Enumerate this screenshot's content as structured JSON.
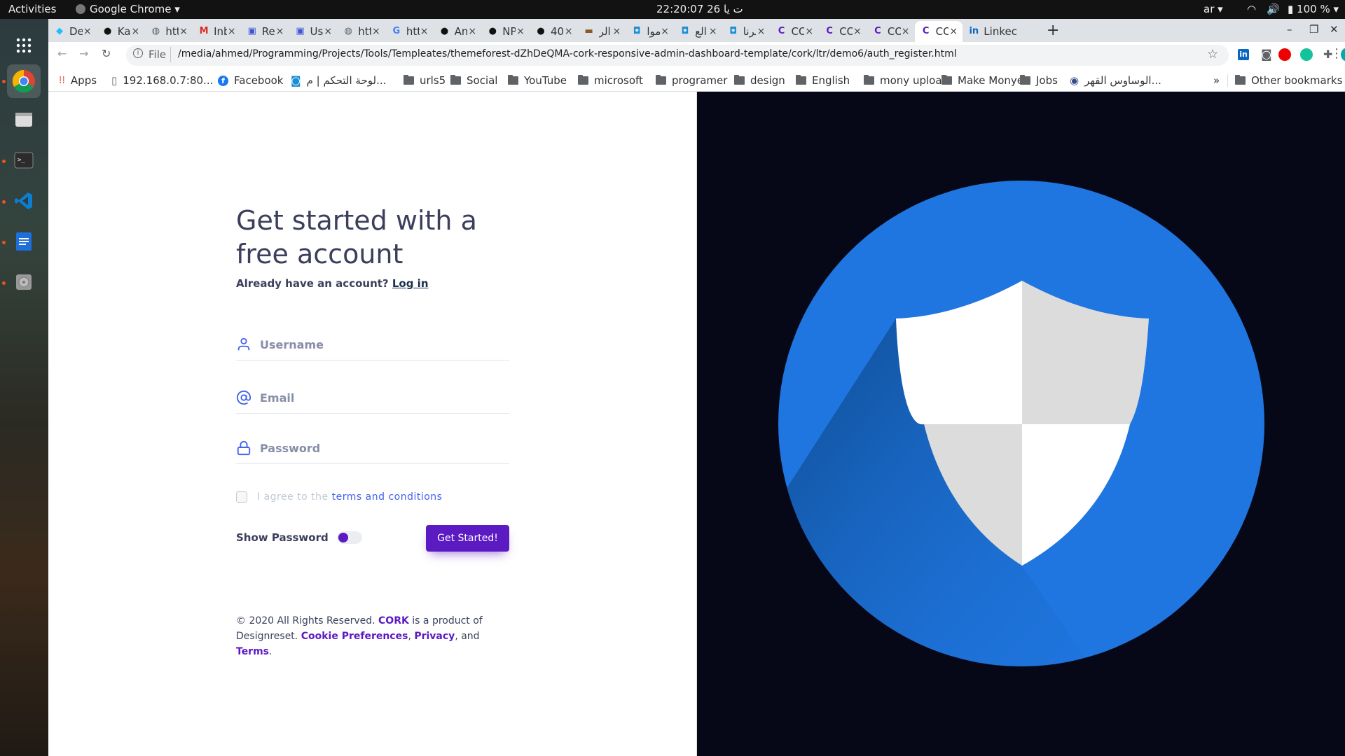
{
  "topbar": {
    "activities": "Activities",
    "app": "Google Chrome",
    "clock": "22:20:07 26 ت يا",
    "lang": "ar",
    "battery": "100 %"
  },
  "tabs": [
    {
      "label": "De",
      "icon": "kaggle-icon"
    },
    {
      "label": "Ka",
      "icon": "github-icon"
    },
    {
      "label": "htt",
      "icon": "globe-icon"
    },
    {
      "label": "Inb",
      "icon": "gmail-icon"
    },
    {
      "label": "Re",
      "icon": "doc-icon"
    },
    {
      "label": "Usi",
      "icon": "doc-icon"
    },
    {
      "label": "htt",
      "icon": "globe-icon"
    },
    {
      "label": "htt",
      "icon": "google-icon"
    },
    {
      "label": "An",
      "icon": "github-icon"
    },
    {
      "label": "NP",
      "icon": "github-icon"
    },
    {
      "label": "40",
      "icon": "github-icon"
    },
    {
      "label": "الر",
      "icon": "book-icon"
    },
    {
      "label": "موا",
      "icon": "camera-icon"
    },
    {
      "label": "الع",
      "icon": "camera-icon"
    },
    {
      "label": "برنا",
      "icon": "camera-icon"
    },
    {
      "label": "CO",
      "icon": "cork-icon"
    },
    {
      "label": "CO",
      "icon": "cork-icon"
    },
    {
      "label": "CORK",
      "icon": "cork-icon"
    },
    {
      "label": "CO",
      "icon": "cork-icon",
      "active": true
    },
    {
      "label": "Linkec",
      "icon": "linkedin-icon"
    }
  ],
  "address": {
    "scheme_label": "File",
    "url": "/media/ahmed/Programming/Projects/Tools/Templeates/themeforest-dZhDeQMA-cork-responsive-admin-dashboard-template/cork/ltr/demo6/auth_register.html"
  },
  "bookmarks": {
    "items": [
      "Apps",
      "192.168.0.7:80...",
      "Facebook",
      "لوحة التحكم | م...",
      "urls5",
      "Social",
      "YouTube",
      "microsoft",
      "programer",
      "design",
      "English",
      "mony upload",
      "Make Monye",
      "Jobs",
      "الوساوس القهر..."
    ],
    "overflow": "»",
    "other": "Other bookmarks"
  },
  "form": {
    "heading": "Get started with a free account",
    "already": "Already have an account?",
    "login": "Log in",
    "username_placeholder": "Username",
    "email_placeholder": "Email",
    "password_placeholder": "Password",
    "agree": "I agree to the",
    "terms": "terms and conditions",
    "show_password": "Show Password",
    "submit": "Get Started!"
  },
  "footer": {
    "t1": "© 2020 All Rights Reserved.",
    "brand": "CORK",
    "t2": "is a product of Designreset.",
    "cookie": "Cookie Preferences",
    "comma": ",",
    "privacy": "Privacy",
    "and": ", and",
    "terms": "Terms",
    "dot": "."
  },
  "colors": {
    "accent": "#5c1ac3",
    "link": "#4361ee",
    "heading": "#3b3f5c",
    "hero_bg": "#060818",
    "circle": "#1f76e0"
  }
}
